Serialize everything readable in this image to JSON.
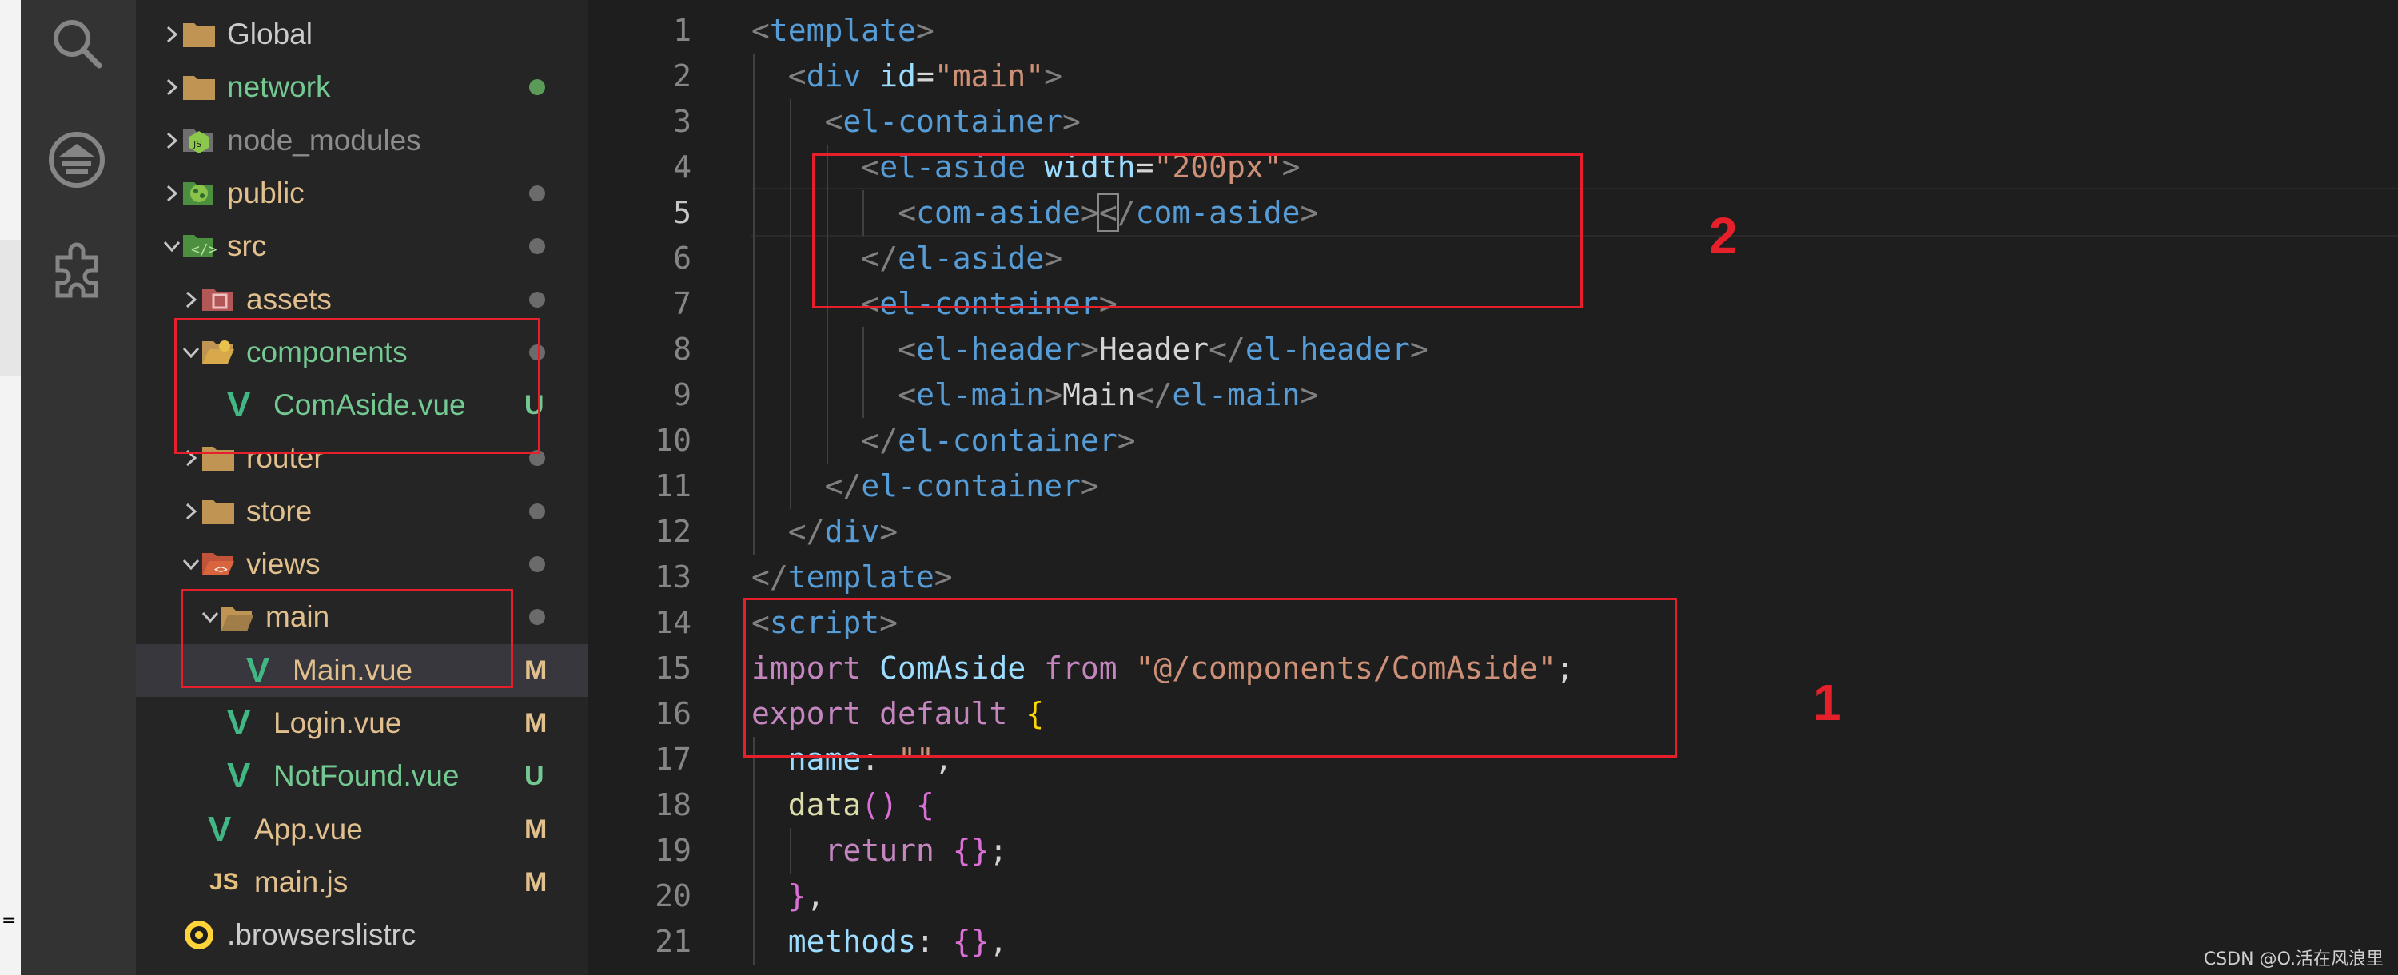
{
  "explorer": {
    "items": [
      {
        "name": "Global",
        "kind": "folder",
        "open": false,
        "color": "#cccccc",
        "status": "",
        "depth": 0
      },
      {
        "name": "network",
        "kind": "folder",
        "open": false,
        "color": "#73c991",
        "status": "dot-green",
        "depth": 0
      },
      {
        "name": "node_modules",
        "kind": "node",
        "open": false,
        "color": "#8c8c8c",
        "status": "",
        "depth": 0
      },
      {
        "name": "public",
        "kind": "public",
        "open": false,
        "color": "#e2c08d",
        "status": "dot",
        "depth": 0
      },
      {
        "name": "src",
        "kind": "src",
        "open": true,
        "color": "#e2c08d",
        "status": "dot",
        "depth": 0
      },
      {
        "name": "assets",
        "kind": "assets",
        "open": false,
        "color": "#e2c08d",
        "status": "dot",
        "depth": 1
      },
      {
        "name": "components",
        "kind": "components",
        "open": true,
        "color": "#73c991",
        "status": "dot",
        "depth": 1
      },
      {
        "name": "ComAside.vue",
        "kind": "vue",
        "color": "#73c991",
        "status": "U",
        "depth": 2
      },
      {
        "name": "router",
        "kind": "folder",
        "open": false,
        "color": "#e2c08d",
        "status": "dot",
        "depth": 1
      },
      {
        "name": "store",
        "kind": "folder",
        "open": false,
        "color": "#e2c08d",
        "status": "dot",
        "depth": 1
      },
      {
        "name": "views",
        "kind": "views",
        "open": true,
        "color": "#e2c08d",
        "status": "dot",
        "depth": 1
      },
      {
        "name": "main",
        "kind": "folder-open",
        "open": true,
        "color": "#e2c08d",
        "status": "dot",
        "depth": 2
      },
      {
        "name": "Main.vue",
        "kind": "vue",
        "color": "#e2c08d",
        "status": "M",
        "depth": 3,
        "selected": true
      },
      {
        "name": "Login.vue",
        "kind": "vue",
        "color": "#e2c08d",
        "status": "M",
        "depth": 2
      },
      {
        "name": "NotFound.vue",
        "kind": "vue",
        "color": "#73c991",
        "status": "U",
        "depth": 2
      },
      {
        "name": "App.vue",
        "kind": "vue",
        "color": "#e2c08d",
        "status": "M",
        "depth": 1
      },
      {
        "name": "main.js",
        "kind": "js",
        "color": "#e2c08d",
        "status": "M",
        "depth": 1
      },
      {
        "name": ".browserslistrc",
        "kind": "browsers",
        "color": "#cccccc",
        "status": "",
        "depth": 0
      }
    ]
  },
  "editor": {
    "active_line": 5,
    "lines": [
      {
        "n": 1,
        "indent": 0,
        "tokens": [
          [
            "br",
            "<"
          ],
          [
            "tag",
            "template"
          ],
          [
            "br",
            ">"
          ]
        ]
      },
      {
        "n": 2,
        "indent": 1,
        "tokens": [
          [
            "br",
            "<"
          ],
          [
            "tag",
            "div"
          ],
          [
            "txt",
            " "
          ],
          [
            "attr",
            "id"
          ],
          [
            "txt",
            "="
          ],
          [
            "str",
            "\"main\""
          ],
          [
            "br",
            ">"
          ]
        ]
      },
      {
        "n": 3,
        "indent": 2,
        "tokens": [
          [
            "br",
            "<"
          ],
          [
            "tag",
            "el-container"
          ],
          [
            "br",
            ">"
          ]
        ]
      },
      {
        "n": 4,
        "indent": 3,
        "tokens": [
          [
            "br",
            "<"
          ],
          [
            "tag",
            "el-aside"
          ],
          [
            "txt",
            " "
          ],
          [
            "attr",
            "width"
          ],
          [
            "txt",
            "="
          ],
          [
            "str",
            "\"200px\""
          ],
          [
            "br",
            ">"
          ]
        ]
      },
      {
        "n": 5,
        "indent": 4,
        "tokens": [
          [
            "br",
            "<"
          ],
          [
            "tag",
            "com-aside"
          ],
          [
            "br",
            ">"
          ],
          [
            "cur",
            "<"
          ],
          [
            "br",
            "/"
          ],
          [
            "tag",
            "com-aside"
          ],
          [
            "br",
            ">"
          ]
        ]
      },
      {
        "n": 6,
        "indent": 3,
        "tokens": [
          [
            "br",
            "</"
          ],
          [
            "tag",
            "el-aside"
          ],
          [
            "br",
            ">"
          ]
        ]
      },
      {
        "n": 7,
        "indent": 3,
        "tokens": [
          [
            "br",
            "<"
          ],
          [
            "tag",
            "el-container"
          ],
          [
            "br",
            ">"
          ]
        ]
      },
      {
        "n": 8,
        "indent": 4,
        "tokens": [
          [
            "br",
            "<"
          ],
          [
            "tag",
            "el-header"
          ],
          [
            "br",
            ">"
          ],
          [
            "txt",
            "Header"
          ],
          [
            "br",
            "</"
          ],
          [
            "tag",
            "el-header"
          ],
          [
            "br",
            ">"
          ]
        ]
      },
      {
        "n": 9,
        "indent": 4,
        "tokens": [
          [
            "br",
            "<"
          ],
          [
            "tag",
            "el-main"
          ],
          [
            "br",
            ">"
          ],
          [
            "txt",
            "Main"
          ],
          [
            "br",
            "</"
          ],
          [
            "tag",
            "el-main"
          ],
          [
            "br",
            ">"
          ]
        ]
      },
      {
        "n": 10,
        "indent": 3,
        "tokens": [
          [
            "br",
            "</"
          ],
          [
            "tag",
            "el-container"
          ],
          [
            "br",
            ">"
          ]
        ]
      },
      {
        "n": 11,
        "indent": 2,
        "tokens": [
          [
            "br",
            "</"
          ],
          [
            "tag",
            "el-container"
          ],
          [
            "br",
            ">"
          ]
        ]
      },
      {
        "n": 12,
        "indent": 1,
        "tokens": [
          [
            "br",
            "</"
          ],
          [
            "tag",
            "div"
          ],
          [
            "br",
            ">"
          ]
        ]
      },
      {
        "n": 13,
        "indent": 0,
        "tokens": [
          [
            "br",
            "</"
          ],
          [
            "tag",
            "template"
          ],
          [
            "br",
            ">"
          ]
        ]
      },
      {
        "n": 14,
        "indent": 0,
        "tokens": [
          [
            "br",
            "<"
          ],
          [
            "tag",
            "script"
          ],
          [
            "br",
            ">"
          ]
        ]
      },
      {
        "n": 15,
        "indent": 0,
        "tokens": [
          [
            "kw",
            "import"
          ],
          [
            "txt",
            " "
          ],
          [
            "attr",
            "ComAside"
          ],
          [
            "txt",
            " "
          ],
          [
            "kw",
            "from"
          ],
          [
            "txt",
            " "
          ],
          [
            "str",
            "\"@/components/ComAside\""
          ],
          [
            "txt",
            ";"
          ]
        ]
      },
      {
        "n": 16,
        "indent": 0,
        "tokens": [
          [
            "kw",
            "export"
          ],
          [
            "txt",
            " "
          ],
          [
            "kw",
            "default"
          ],
          [
            "txt",
            " "
          ],
          [
            "gold",
            "{"
          ]
        ]
      },
      {
        "n": 17,
        "indent": 1,
        "tokens": [
          [
            "attr",
            "name"
          ],
          [
            "txt",
            ": "
          ],
          [
            "str",
            "\"\""
          ],
          [
            "txt",
            ","
          ]
        ]
      },
      {
        "n": 18,
        "indent": 1,
        "tokens": [
          [
            "fn",
            "data"
          ],
          [
            "pk",
            "()"
          ],
          [
            "txt",
            " "
          ],
          [
            "pk",
            "{"
          ]
        ]
      },
      {
        "n": 19,
        "indent": 2,
        "tokens": [
          [
            "kw",
            "return"
          ],
          [
            "txt",
            " "
          ],
          [
            "pk",
            "{}"
          ],
          [
            "txt",
            ";"
          ]
        ]
      },
      {
        "n": 20,
        "indent": 1,
        "tokens": [
          [
            "pk",
            "}"
          ],
          [
            "txt",
            ","
          ]
        ]
      },
      {
        "n": 21,
        "indent": 1,
        "tokens": [
          [
            "attr",
            "methods"
          ],
          [
            "txt",
            ": "
          ],
          [
            "pk",
            "{}"
          ],
          [
            "txt",
            ","
          ]
        ]
      }
    ]
  },
  "annotations": [
    {
      "label": "1"
    },
    {
      "label": "2"
    }
  ],
  "watermark": "CSDN @O.活在风浪里"
}
